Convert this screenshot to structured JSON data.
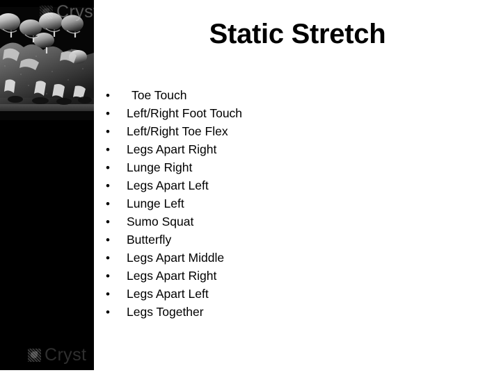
{
  "slide": {
    "title": "Static Stretch",
    "bullet_marker": "•",
    "background_color": "#ffffff",
    "panel_color": "#000000",
    "text_color": "#000000"
  },
  "photo": {
    "alt": "Black and white photo of an American football offensive line at the line of scrimmage",
    "watermark_top": "Cryst",
    "watermark_bottom": "Cryst",
    "watermark_logo": "crystal-graphics-logo"
  },
  "bullets": [
    {
      "label": "Toe Touch",
      "indented": true
    },
    {
      "label": "Left/Right Foot Touch",
      "indented": false
    },
    {
      "label": "Left/Right Toe Flex",
      "indented": false
    },
    {
      "label": "Legs Apart Right",
      "indented": false
    },
    {
      "label": "Lunge Right",
      "indented": false
    },
    {
      "label": "Legs Apart Left",
      "indented": false
    },
    {
      "label": "Lunge Left",
      "indented": false
    },
    {
      "label": "Sumo Squat",
      "indented": false
    },
    {
      "label": "Butterfly",
      "indented": false
    },
    {
      "label": "Legs Apart Middle",
      "indented": false
    },
    {
      "label": "Legs Apart Right",
      "indented": false
    },
    {
      "label": "Legs Apart Left",
      "indented": false
    },
    {
      "label": "Legs Together",
      "indented": false
    }
  ]
}
